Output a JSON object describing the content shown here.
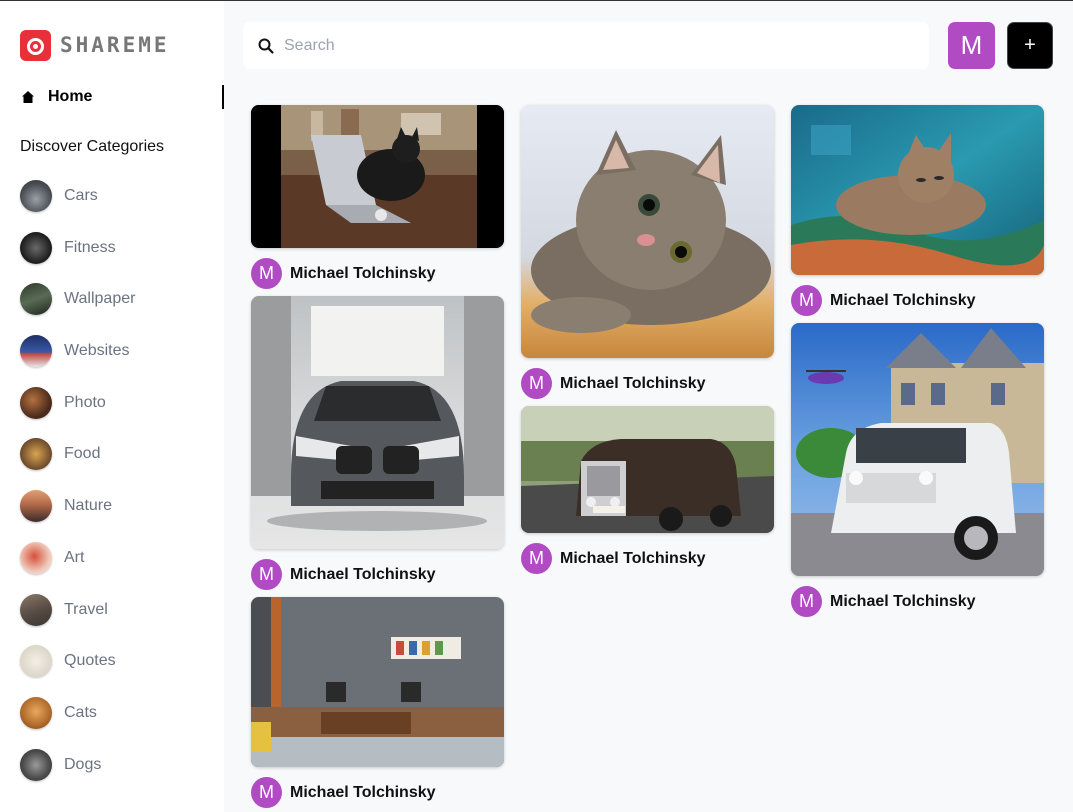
{
  "app": {
    "name": "SHAREME"
  },
  "sidebar": {
    "home_label": "Home",
    "categories_heading": "Discover Categories",
    "categories": [
      {
        "label": "Cars",
        "thumb_color": "#5b5f66"
      },
      {
        "label": "Fitness",
        "thumb_color": "#2b2b2b"
      },
      {
        "label": "Wallpaper",
        "thumb_color": "#3d4a3a"
      },
      {
        "label": "Websites",
        "thumb_color": "#2a3f7a"
      },
      {
        "label": "Photo",
        "thumb_color": "#5a3a2a"
      },
      {
        "label": "Food",
        "thumb_color": "#8a6a3a"
      },
      {
        "label": "Nature",
        "thumb_color": "#a06a4a"
      },
      {
        "label": "Art",
        "thumb_color": "#d26a5a"
      },
      {
        "label": "Travel",
        "thumb_color": "#6a6058"
      },
      {
        "label": "Quotes",
        "thumb_color": "#e6e2d8"
      },
      {
        "label": "Cats",
        "thumb_color": "#c8843a"
      },
      {
        "label": "Dogs",
        "thumb_color": "#5a5a5a"
      }
    ]
  },
  "header": {
    "search_placeholder": "Search",
    "user_initial": "M",
    "add_label": "+"
  },
  "pins": [
    {
      "author": "Michael Tolchinsky",
      "initial": "M",
      "image": "cat with laptop"
    },
    {
      "author": "Michael Tolchinsky",
      "initial": "M",
      "image": "tabby kitten"
    },
    {
      "author": "Michael Tolchinsky",
      "initial": "M",
      "image": "cat on blanket"
    },
    {
      "author": "Michael Tolchinsky",
      "initial": "M",
      "image": "grey BMW"
    },
    {
      "author": "Michael Tolchinsky",
      "initial": "M",
      "image": "Rolls-Royce"
    },
    {
      "author": "Michael Tolchinsky",
      "initial": "M",
      "image": "white G-Class"
    },
    {
      "author": "Michael Tolchinsky",
      "initial": "M",
      "image": "living room"
    }
  ],
  "colors": {
    "accent": "#b04bc4",
    "brand": "#e8303a"
  }
}
